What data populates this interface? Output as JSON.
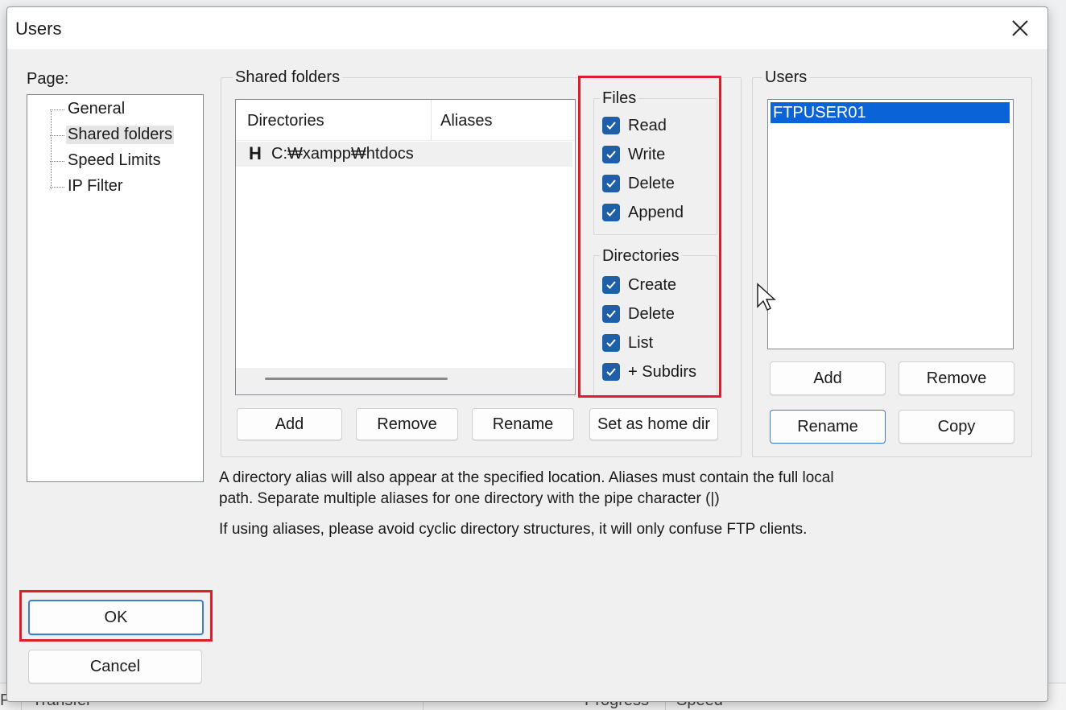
{
  "window": {
    "title": "Users"
  },
  "background_app": {
    "col_transfer": "Transfer",
    "col_progress": "Progress",
    "col_speed": "Speed",
    "col_p": "P"
  },
  "page": {
    "label": "Page:",
    "items": [
      {
        "label": "General",
        "selected": false
      },
      {
        "label": "Shared folders",
        "selected": true
      },
      {
        "label": "Speed Limits",
        "selected": false
      },
      {
        "label": "IP Filter",
        "selected": false
      }
    ]
  },
  "shared_folders": {
    "title": "Shared folders",
    "col_directories": "Directories",
    "col_aliases": "Aliases",
    "rows": [
      {
        "marker": "H",
        "path": "C:₩xampp₩htdocs",
        "alias": ""
      }
    ],
    "buttons": {
      "add": "Add",
      "remove": "Remove",
      "rename": "Rename",
      "set_home": "Set as home dir"
    }
  },
  "files": {
    "title": "Files",
    "read": "Read",
    "write": "Write",
    "delete": "Delete",
    "append": "Append",
    "read_checked": true,
    "write_checked": true,
    "delete_checked": true,
    "append_checked": true
  },
  "directories": {
    "title": "Directories",
    "create": "Create",
    "delete": "Delete",
    "list": "List",
    "subdirs": "+ Subdirs",
    "create_checked": true,
    "delete_checked": true,
    "list_checked": true,
    "subdirs_checked": true
  },
  "users": {
    "title": "Users",
    "list": [
      "FTPUSER01"
    ],
    "selected": "FTPUSER01",
    "buttons": {
      "add": "Add",
      "remove": "Remove",
      "rename": "Rename",
      "copy": "Copy"
    }
  },
  "description": {
    "line1": "A directory alias will also appear at the specified location. Aliases must contain the full local",
    "line2": "path. Separate multiple aliases for one directory with the pipe character (|)",
    "line3": "If using aliases, please avoid cyclic directory structures, it will only confuse FTP clients."
  },
  "footer": {
    "ok": "OK",
    "cancel": "Cancel"
  },
  "colors": {
    "highlight": "#e01e2b",
    "checkbox": "#1f5fa8",
    "selection": "#0a64d8"
  }
}
